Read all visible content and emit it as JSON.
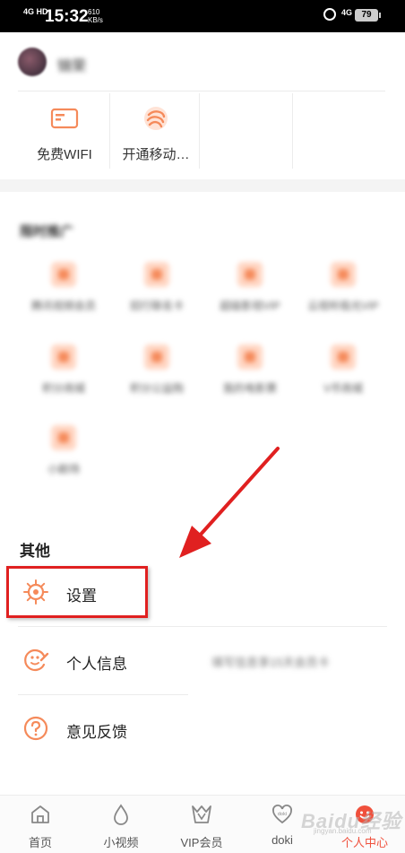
{
  "status_bar": {
    "network": "4G HD",
    "time": "15:32",
    "speed": "610\nKB/s",
    "network2": "4G",
    "battery": "79"
  },
  "profile": {
    "name": "锦荣"
  },
  "services": [
    {
      "label": "免费WIFI",
      "icon": "wifi-card-icon"
    },
    {
      "label": "开通移动…",
      "icon": "china-mobile-icon"
    }
  ],
  "promo": {
    "title": "限时推广",
    "items": [
      {
        "label": "腾讯视频会员"
      },
      {
        "label": "招行联名卡"
      },
      {
        "label": "超级影视VIP"
      },
      {
        "label": "云视听极光VIP"
      },
      {
        "label": "积分商城"
      },
      {
        "label": "积分公益购"
      },
      {
        "label": "我的电影票"
      },
      {
        "label": "V币商城"
      },
      {
        "label": "小剧场"
      }
    ]
  },
  "others": {
    "title": "其他",
    "items": [
      {
        "label": "设置",
        "icon": "gear-icon"
      },
      {
        "label": "个人信息",
        "icon": "smiley-wrench-icon",
        "side_text": "填写信息享15天会员卡"
      },
      {
        "label": "意见反馈",
        "icon": "question-icon"
      }
    ]
  },
  "tabbar": {
    "tabs": [
      {
        "label": "首页",
        "icon": "home-icon"
      },
      {
        "label": "小视频",
        "icon": "drop-icon"
      },
      {
        "label": "VIP会员",
        "icon": "vip-crown-icon"
      },
      {
        "label": "doki",
        "icon": "doki-heart-icon"
      },
      {
        "label": "个人中心",
        "icon": "smiley-icon",
        "active": true
      }
    ]
  },
  "watermark": {
    "main": "Baidu经验",
    "sub": "jingyan.baidu.com"
  },
  "colors": {
    "accent": "#f58a5a",
    "active_tab": "#f0503c",
    "highlight": "#e02020",
    "arrow": "#e02020"
  }
}
